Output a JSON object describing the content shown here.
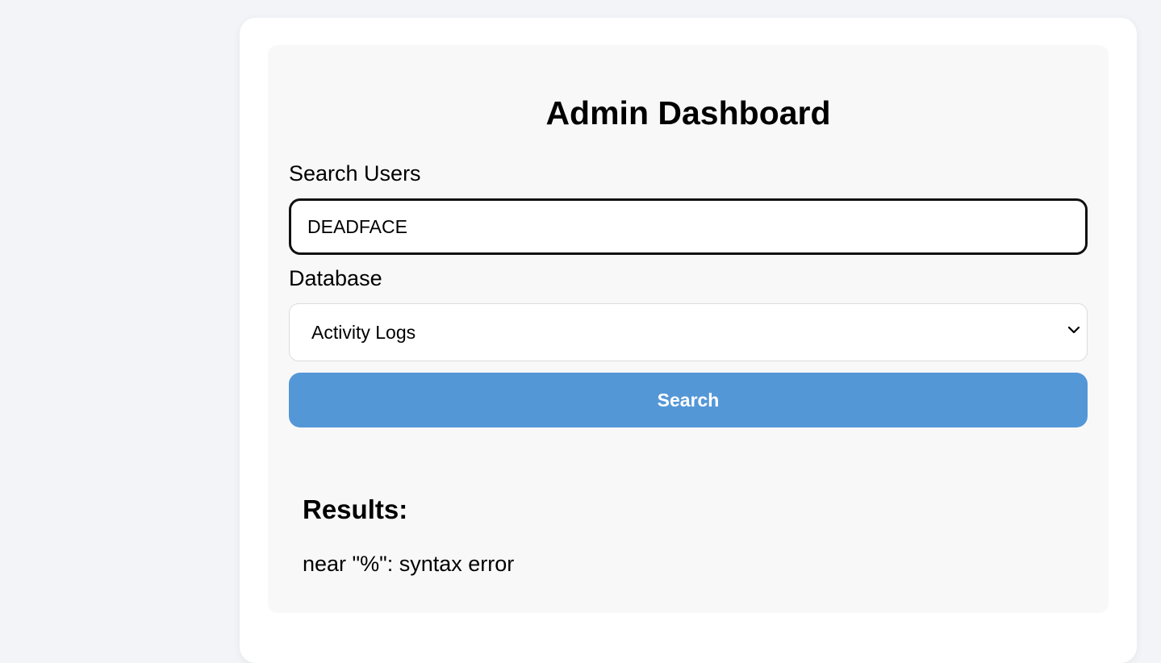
{
  "dashboard": {
    "title": "Admin Dashboard"
  },
  "search": {
    "label": "Search Users",
    "value": "DEADFACE",
    "placeholder": ""
  },
  "database": {
    "label": "Database",
    "selected": "Activity Logs"
  },
  "search_button": {
    "label": "Search",
    "color": "#5497d7"
  },
  "results": {
    "heading": "Results:",
    "message": "near \"%\": syntax error"
  }
}
